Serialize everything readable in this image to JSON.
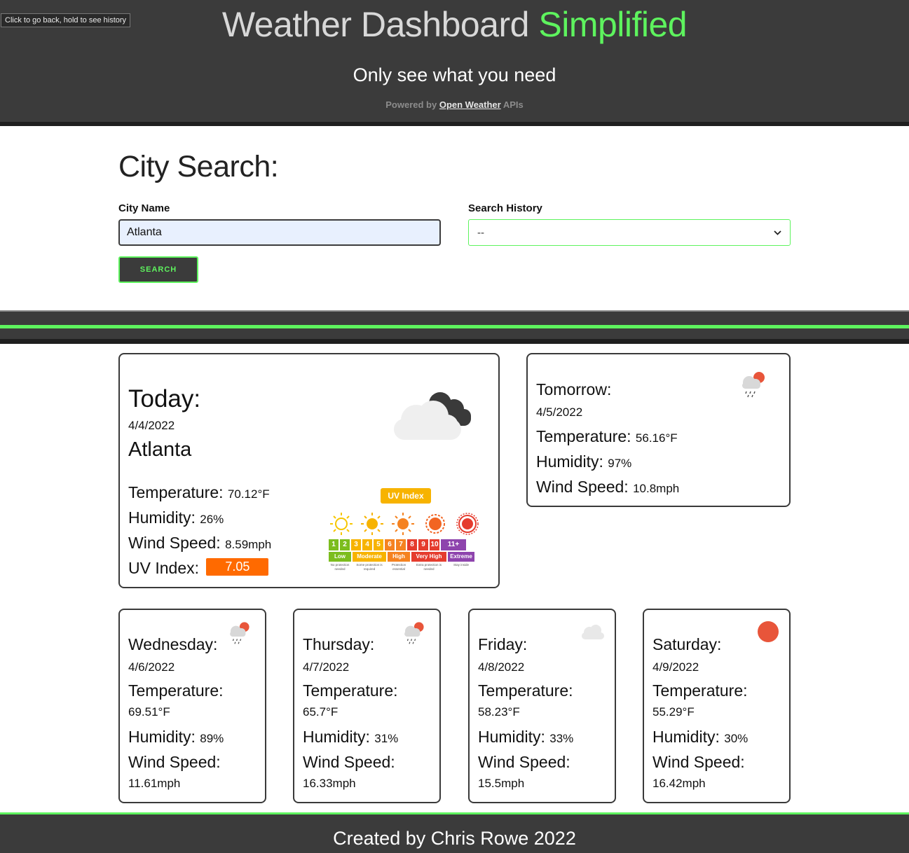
{
  "header": {
    "title_main": "Weather Dashboard",
    "title_accent": "Simplified",
    "subtitle": "Only see what you need",
    "powered_prefix": "Powered by",
    "powered_link": "Open Weather",
    "powered_suffix": "APIs",
    "back_tooltip": "Click to go back, hold to see history"
  },
  "search": {
    "heading": "City Search:",
    "city_label": "City Name",
    "city_value": "Atlanta",
    "history_label": "Search History",
    "history_selected": "--",
    "button_label": "SEARCH"
  },
  "today": {
    "heading": "Today:",
    "date": "4/4/2022",
    "city": "Atlanta",
    "temperature_label": "Temperature:",
    "temperature": "70.12°F",
    "humidity_label": "Humidity:",
    "humidity": "26%",
    "wind_label": "Wind Speed:",
    "wind": "8.59mph",
    "uv_label": "UV Index:",
    "uv": "7.05",
    "icon": "cloud-dark-icon"
  },
  "uv_chart": {
    "title": "UV Index",
    "levels": [
      "1",
      "2",
      "3",
      "4",
      "5",
      "6",
      "7",
      "8",
      "9",
      "10",
      "11+"
    ],
    "categories": [
      "Low",
      "Moderate",
      "High",
      "Very High",
      "Extreme"
    ],
    "notes": [
      "No protection needed",
      "Some protection is required",
      "Protection essential",
      "Extra protection is needed",
      "Stay inside"
    ],
    "colors": [
      "#7cbd1e",
      "#f7b300",
      "#f58220",
      "#e53c2e",
      "#8e44ad"
    ]
  },
  "tomorrow": {
    "heading": "Tomorrow:",
    "date": "4/5/2022",
    "temperature_label": "Temperature:",
    "temperature": "56.16°F",
    "humidity_label": "Humidity:",
    "humidity": "97%",
    "wind_label": "Wind Speed:",
    "wind": "10.8mph",
    "icon": "rain-sun-icon"
  },
  "forecast": [
    {
      "day": "Wednesday:",
      "date": "4/6/2022",
      "temperature": "69.51°F",
      "humidity": "89%",
      "wind": "11.61mph",
      "icon": "rain-sun-icon"
    },
    {
      "day": "Thursday:",
      "date": "4/7/2022",
      "temperature": "65.7°F",
      "humidity": "31%",
      "wind": "16.33mph",
      "icon": "rain-sun-icon"
    },
    {
      "day": "Friday:",
      "date": "4/8/2022",
      "temperature": "58.23°F",
      "humidity": "33%",
      "wind": "15.5mph",
      "icon": "cloud-icon"
    },
    {
      "day": "Saturday:",
      "date": "4/9/2022",
      "temperature": "55.29°F",
      "humidity": "30%",
      "wind": "16.42mph",
      "icon": "sun-icon"
    }
  ],
  "labels": {
    "temperature": "Temperature:",
    "humidity": "Humidity:",
    "wind": "Wind Speed:"
  },
  "footer": {
    "text": "Created by Chris Rowe 2022"
  },
  "colors": {
    "accent": "#5ef35e",
    "header_bg": "#3b3b3b",
    "uv_badge": "#ff6a00"
  }
}
